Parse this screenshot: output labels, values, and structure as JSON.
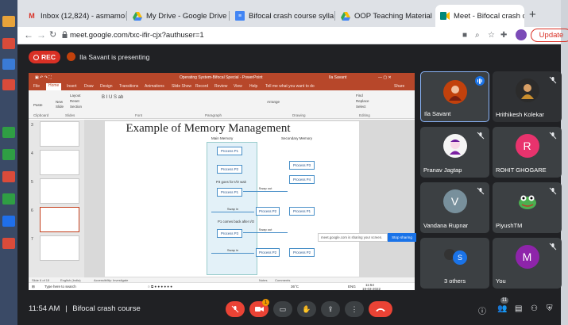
{
  "browser": {
    "tabs": [
      {
        "title": "Inbox (12,824) - asmamoh",
        "icon": "gmail-icon"
      },
      {
        "title": "My Drive - Google Drive",
        "icon": "drive-icon"
      },
      {
        "title": "Bifocal crash course sylla",
        "icon": "docs-icon"
      },
      {
        "title": "OOP Teaching Material -",
        "icon": "drive-icon"
      },
      {
        "title": "Meet - Bifocal crash c",
        "icon": "meet-icon"
      }
    ],
    "new_tab": "+",
    "url": "meet.google.com/txc-ifir-cjx?authuser=1",
    "update_label": "Update"
  },
  "meet": {
    "rec_label": "REC",
    "presenting_text": "Ila Savant is presenting",
    "clock": "11:54 AM",
    "separator": "|",
    "meeting_name": "Bifocal crash course",
    "chat_badge": "1",
    "people_badge": "11"
  },
  "presentation": {
    "window_title": "Operating System-Bifocal Special - PowerPoint",
    "user": "Ila Savant",
    "ribbon_tabs": [
      "File",
      "Home",
      "Insert",
      "Draw",
      "Design",
      "Transitions",
      "Animations",
      "Slide Show",
      "Record",
      "Review",
      "View",
      "Help"
    ],
    "tell_me": "Tell me what you want to do",
    "share": "Share",
    "ribbon_items": {
      "paste": "Paste",
      "new": "New",
      "slide": "Slide",
      "layout": "Layout",
      "reset": "Reset",
      "section": "Section",
      "find": "Find",
      "replace": "Replace",
      "select": "Select",
      "arrange": "Arrange"
    },
    "ribbon_groups": [
      "Clipboard",
      "Slides",
      "Font",
      "Paragraph",
      "Drawing",
      "Editing"
    ],
    "slide_numbers": [
      "3",
      "4",
      "5",
      "6",
      "7"
    ],
    "slide_title": "Example of Memory Management",
    "main_memory_label": "Main Memory",
    "secondary_memory_label": "Secondary Memory",
    "main_processes": [
      "Process P1",
      "Process P2",
      "Process P1",
      "Process P3"
    ],
    "secondary_processes": [
      "Process P3",
      "Process P4",
      "Process P1",
      "Process P2"
    ],
    "notes": [
      "P3 goes for I/O wait",
      "P1 comes back after I/O"
    ],
    "arrow_labels": [
      "Swap out",
      "Swap in",
      "Swap out",
      "Swap in"
    ],
    "lower_processes": [
      "Process P2",
      "Process P2"
    ],
    "status_bar": {
      "slide_of": "Slide 6 of 15",
      "language": "English (India)",
      "accessibility": "Accessibility: Investigate",
      "notes": "Notes",
      "comments": "Comments"
    },
    "sharing_note": "meet.google.com is sharing your screen.",
    "stop_sharing": "Stop sharing",
    "taskbar": {
      "search": "Type here to search",
      "temp": "36°C",
      "lang": "ENG",
      "time": "11:54",
      "date": "19-03-2022"
    }
  },
  "participants": [
    {
      "name": "Ila Savant",
      "avatar_color": "#c2410c",
      "initial": "",
      "speaking": true
    },
    {
      "name": "Hrithikesh Kolekar",
      "avatar_color": "#2b2b2b",
      "initial": "",
      "speaking": false
    },
    {
      "name": "Pranav Jagtap",
      "avatar_color": "#f5f5f5",
      "initial": "",
      "speaking": false
    },
    {
      "name": "ROHIT GHOGARE",
      "avatar_color": "#e8336d",
      "initial": "R",
      "speaking": false
    },
    {
      "name": "Vandana Rupnar",
      "avatar_color": "#78909c",
      "initial": "V",
      "speaking": false
    },
    {
      "name": "PiyushTM",
      "avatar_color": "#3c4043",
      "initial": "",
      "speaking": false
    },
    {
      "name": "3 others",
      "avatar_color": "#1a73e8",
      "initial": "S",
      "speaking": false
    },
    {
      "name": "You",
      "avatar_color": "#8e24aa",
      "initial": "M",
      "speaking": false
    }
  ]
}
